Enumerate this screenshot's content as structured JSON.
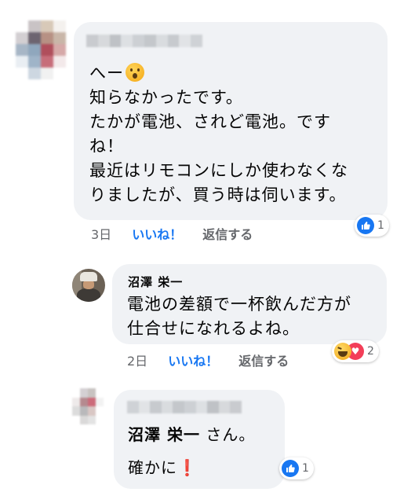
{
  "comment1": {
    "author_hidden": true,
    "line1": "へー",
    "emoji1": "surprised-face-emoji",
    "line2": "知らなかったです。",
    "line3": "たかが電池、されど電池。です",
    "line4": "ね！",
    "line5": "最近はリモコンにしか使わなくな",
    "line6": "りましたが、買う時は伺います。",
    "time": "3日",
    "like_label": "いいね！",
    "reply_label": "返信する",
    "reaction_count": "1",
    "reaction_icon": "like-icon"
  },
  "comment2": {
    "author": "沼澤 栄一",
    "line1": "電池の差額で一杯飲んだ方が",
    "line2": "仕合せになれるよね。",
    "time": "2日",
    "like_label": "いいね！",
    "reply_label": "返信する",
    "reaction_count": "2",
    "reaction_icons": [
      "haha-icon",
      "heart-icon"
    ]
  },
  "comment3": {
    "author_hidden": true,
    "mention": "沼澤 栄一",
    "mention_suffix": "さん。",
    "line2": "確かに",
    "emoji": "❗",
    "reaction_count": "1",
    "reaction_icon": "like-icon"
  },
  "colors": {
    "bubble": "#f0f2f5",
    "link_blue": "#1877f2",
    "meta_gray": "#65676b",
    "heart_red": "#f33e58"
  }
}
